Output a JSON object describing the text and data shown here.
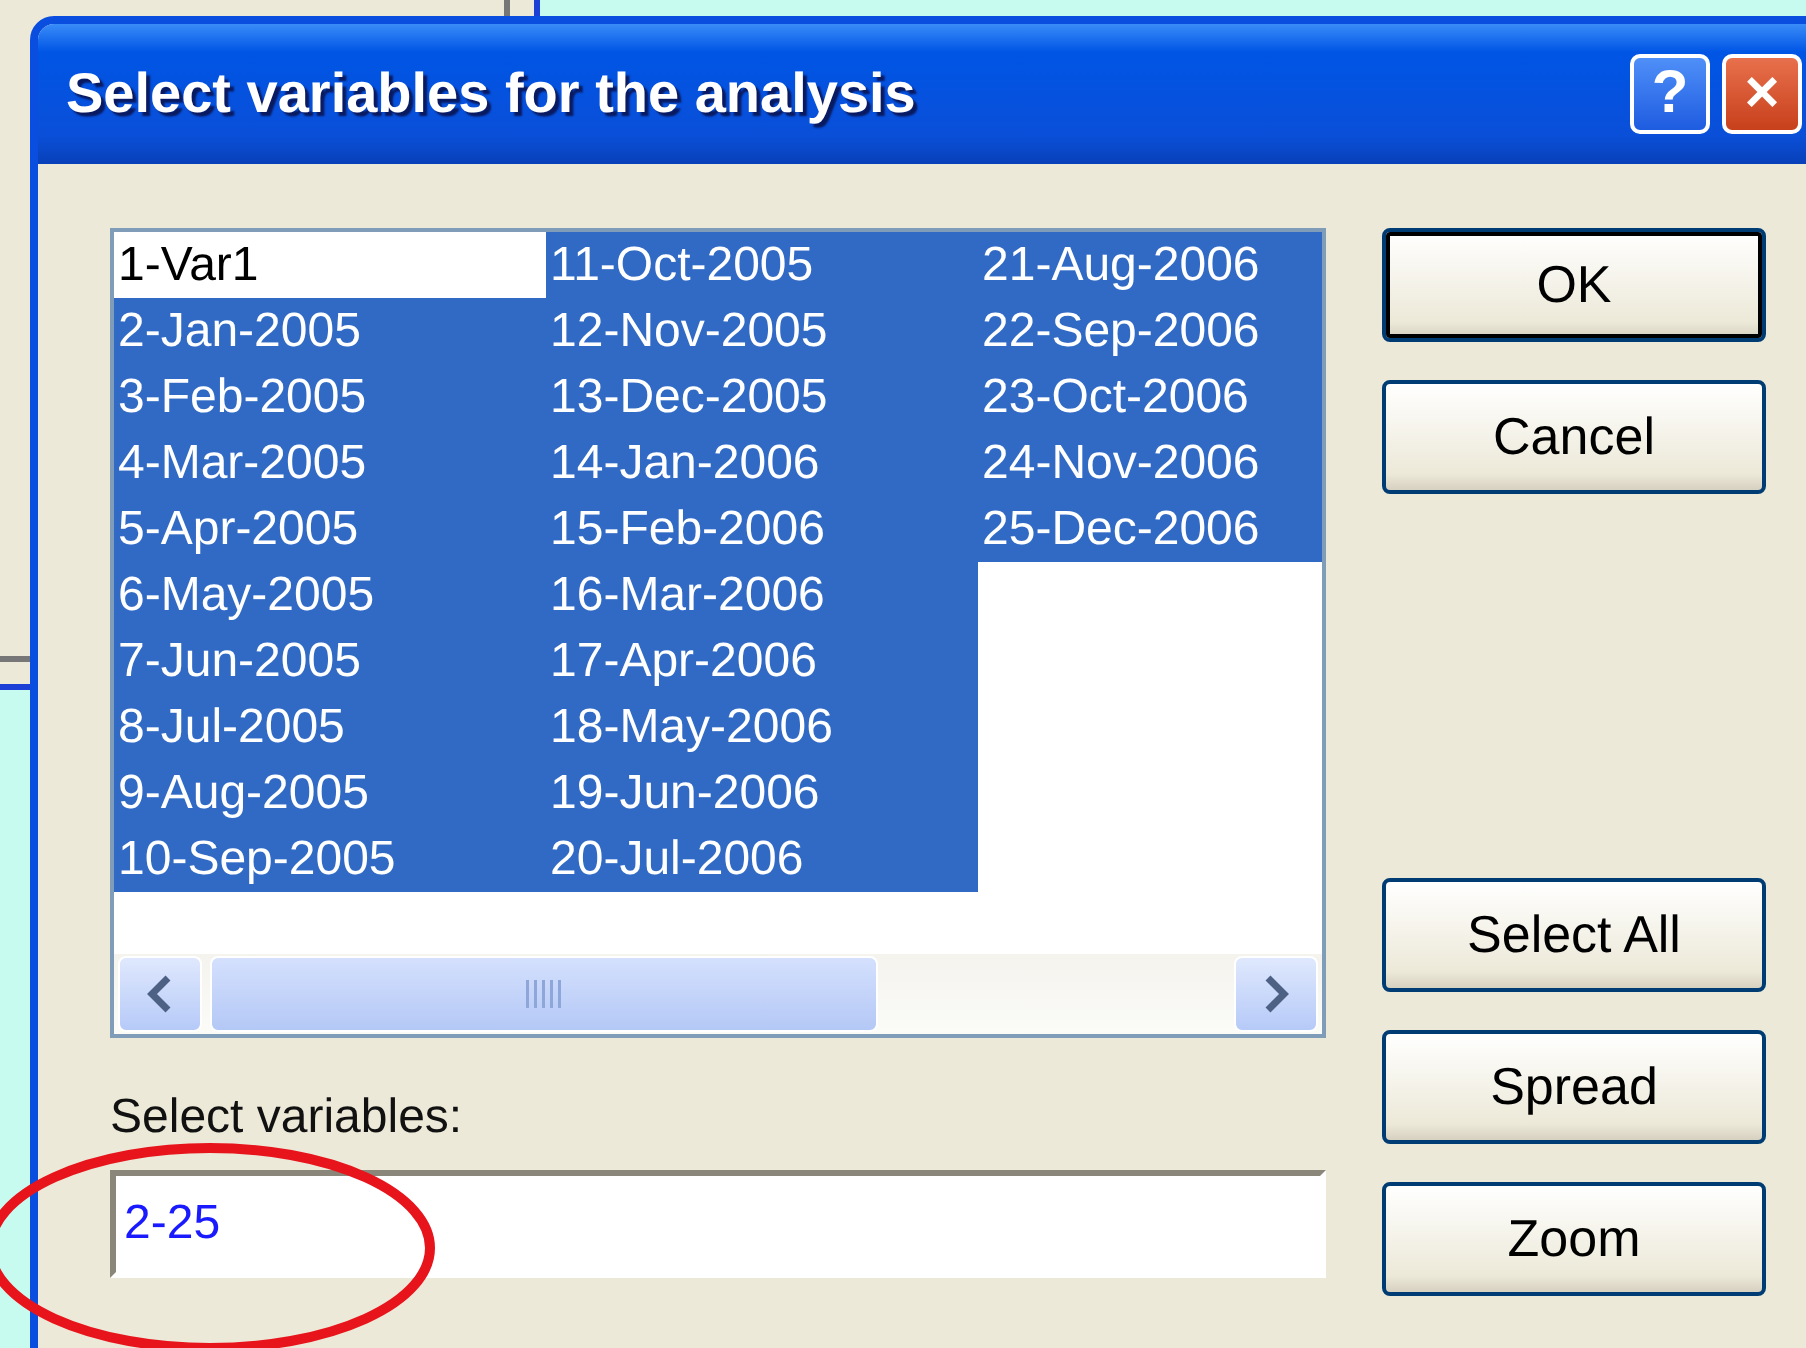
{
  "window": {
    "title": "Select variables for the analysis",
    "help_button": "?",
    "close_button": "×"
  },
  "variables": [
    {
      "label": "1-Var1",
      "selected": false
    },
    {
      "label": "2-Jan-2005",
      "selected": true
    },
    {
      "label": "3-Feb-2005",
      "selected": true
    },
    {
      "label": "4-Mar-2005",
      "selected": true
    },
    {
      "label": "5-Apr-2005",
      "selected": true
    },
    {
      "label": "6-May-2005",
      "selected": true
    },
    {
      "label": "7-Jun-2005",
      "selected": true
    },
    {
      "label": "8-Jul-2005",
      "selected": true
    },
    {
      "label": "9-Aug-2005",
      "selected": true
    },
    {
      "label": "10-Sep-2005",
      "selected": true
    },
    {
      "label": "11-Oct-2005",
      "selected": true
    },
    {
      "label": "12-Nov-2005",
      "selected": true
    },
    {
      "label": "13-Dec-2005",
      "selected": true
    },
    {
      "label": "14-Jan-2006",
      "selected": true
    },
    {
      "label": "15-Feb-2006",
      "selected": true
    },
    {
      "label": "16-Mar-2006",
      "selected": true
    },
    {
      "label": "17-Apr-2006",
      "selected": true
    },
    {
      "label": "18-May-2006",
      "selected": true
    },
    {
      "label": "19-Jun-2006",
      "selected": true
    },
    {
      "label": "20-Jul-2006",
      "selected": true
    },
    {
      "label": "21-Aug-2006",
      "selected": true
    },
    {
      "label": "22-Sep-2006",
      "selected": true
    },
    {
      "label": "23-Oct-2006",
      "selected": true
    },
    {
      "label": "24-Nov-2006",
      "selected": true
    },
    {
      "label": "25-Dec-2006",
      "selected": true
    }
  ],
  "select_field": {
    "label": "Select variables:",
    "value": "2-25"
  },
  "buttons_top": [
    "OK",
    "Cancel"
  ],
  "buttons_bottom": [
    "Select All",
    "Spread",
    "Zoom"
  ]
}
